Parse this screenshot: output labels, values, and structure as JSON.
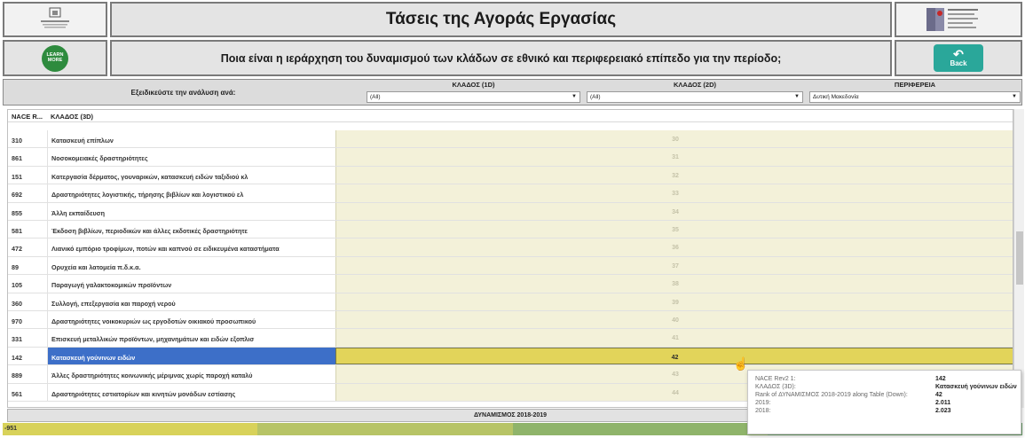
{
  "header": {
    "title": "Τάσεις της Αγοράς Εργασίας",
    "question": "Ποια είναι η ιεράρχηση του δυναμισμού των κλάδων σε εθνικό και περιφερειακό επίπεδο για την περίοδο;",
    "learn_more_line1": "LEARN",
    "learn_more_line2": "MORE",
    "back_label": "Back"
  },
  "filters": {
    "label": "Εξειδικεύστε την ανάλυση ανά:",
    "items": [
      {
        "label": "ΚΛΑΔΟΣ (1D)",
        "value": "(All)"
      },
      {
        "label": "ΚΛΑΔΟΣ (2D)",
        "value": "(All)"
      },
      {
        "label": "ΠΕΡΙΦΕΡΕΙΑ",
        "value": "Δυτική Μακεδονία"
      }
    ]
  },
  "table": {
    "col_code": "NACE R...",
    "col_name": "ΚΛΑΔΟΣ (3D)",
    "rows": [
      {
        "code": "310",
        "name": "Κατασκευή επίπλων",
        "rank": "30"
      },
      {
        "code": "861",
        "name": "Νοσοκομειακές δραστηριότητες",
        "rank": "31"
      },
      {
        "code": "151",
        "name": "Κατεργασία δέρματος, γουναρικών, κατασκευή ειδών ταξιδιού κλ",
        "rank": "32"
      },
      {
        "code": "692",
        "name": "Δραστηριότητες λογιστικής, τήρησης βιβλίων και λογιστικού ελ",
        "rank": "33"
      },
      {
        "code": "855",
        "name": "Άλλη εκπαίδευση",
        "rank": "34"
      },
      {
        "code": "581",
        "name": "Έκδοση βιβλίων, περιοδικών και άλλες εκδοτικές δραστηριότητε",
        "rank": "35"
      },
      {
        "code": "472",
        "name": "Λιανικό εμπόριο τροφίμων, ποτών και καπνού σε ειδικευμένα καταστήματα",
        "rank": "36"
      },
      {
        "code": "89",
        "name": "Ορυχεία και λατομεία π.δ.κ.α.",
        "rank": "37"
      },
      {
        "code": "105",
        "name": "Παραγωγή γαλακτοκομικών προϊόντων",
        "rank": "38"
      },
      {
        "code": "360",
        "name": "Συλλογή, επεξεργασία και παροχή νερού",
        "rank": "39"
      },
      {
        "code": "970",
        "name": "Δραστηριότητες νοικοκυριών ως εργοδοτών οικιακού προσωπικού",
        "rank": "40"
      },
      {
        "code": "331",
        "name": "Επισκευή μεταλλικών προϊόντων, μηχανημάτων και ειδών εξοπλισ",
        "rank": "41"
      },
      {
        "code": "142",
        "name": "Κατασκευή γούνινων ειδών",
        "rank": "42",
        "selected": true
      },
      {
        "code": "889",
        "name": "Άλλες δραστηριότητες κοινωνικής μέριμνας χωρίς παροχή καταλύ",
        "rank": "43"
      },
      {
        "code": "561",
        "name": "Δραστηριότητες εστιατορίων και κινητών μονάδων εστίασης",
        "rank": "44"
      }
    ]
  },
  "footer": {
    "title": "ΔΥΝΑΜΙΣΜΟΣ 2018-2019",
    "min_value": "-951"
  },
  "tooltip": {
    "rows": [
      {
        "key": "NACE Rev2 1:",
        "value": "142"
      },
      {
        "key": "ΚΛΑΔΟΣ (3D):",
        "value": "Κατασκευή γούνινων ειδών"
      },
      {
        "key": "Rank of ΔΥΝΑΜΙΣΜΟΣ 2018-2019 along Table (Down):",
        "value": "42"
      },
      {
        "key": "2019:",
        "value": "2.011"
      },
      {
        "key": "2018:",
        "value": "2.023"
      }
    ]
  },
  "colors": {
    "bar_fill": "#f3f1d9",
    "selected_bar": "#e2d45a",
    "selected_row": "#3d6fc8",
    "back_button": "#2aa79a",
    "learn_more": "#2e8b3e"
  }
}
